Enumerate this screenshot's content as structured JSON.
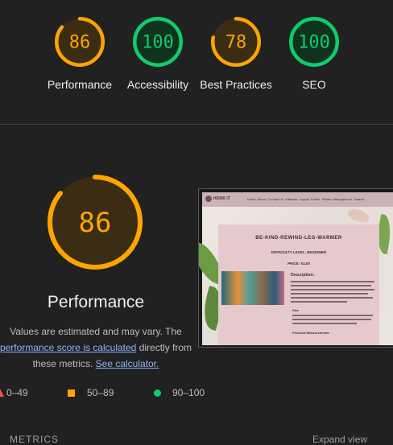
{
  "scores": [
    {
      "name": "performance",
      "value": 86,
      "label": "Performance",
      "status": "average"
    },
    {
      "name": "accessibility",
      "value": 100,
      "label": "Accessibility",
      "status": "pass"
    },
    {
      "name": "best-practices",
      "value": 78,
      "label": "Best Practices",
      "status": "average"
    },
    {
      "name": "seo",
      "value": 100,
      "label": "SEO",
      "status": "pass"
    }
  ],
  "colors": {
    "average": "#ffa400",
    "average_bg": "#3a2d13",
    "pass": "#0cce6b",
    "pass_bg": "#11321f",
    "fail": "#ff4e42",
    "track": "#3a3a3a"
  },
  "main": {
    "score": 86,
    "title": "Performance",
    "desc_1": "Values are estimated and may vary. The ",
    "link_score": "performance score is calculated",
    "desc_2": " directly from these metrics. ",
    "link_calc": "See calculator."
  },
  "legend": {
    "fail_range": "0–49",
    "average_range": "50–89",
    "pass_range": "90–100"
  },
  "metrics_header": "METRICS",
  "expand_view": "Expand view",
  "screenshot": {
    "site_name": "HOOK IT",
    "nav_items": [
      "Home",
      "About",
      "Contact Us",
      "Patterns",
      "Logout",
      "Profile",
      "Pattern Management",
      "Search"
    ],
    "product_title": "BE-KIND-REWIND-LEG-WARMER",
    "difficulty": "DIFFICULTY LEVEL: BEGINNER",
    "price": "PRICE: €4.00",
    "description_heading": "Description:",
    "size_heading": "Size",
    "finished_heading": "Finished Measurements"
  }
}
